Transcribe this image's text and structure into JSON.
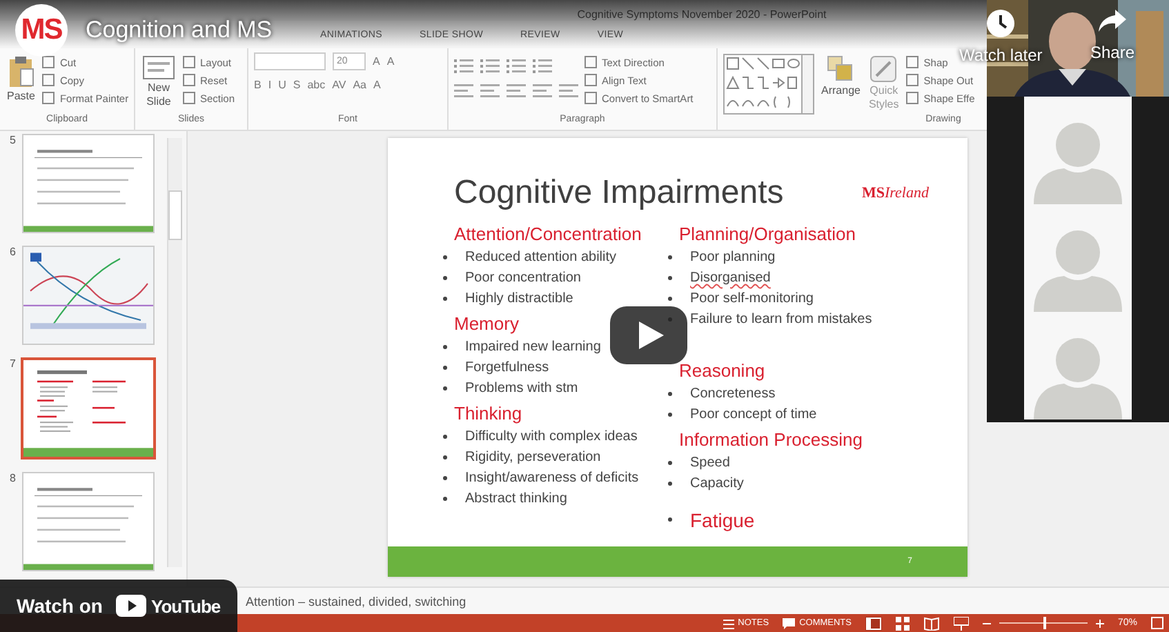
{
  "video": {
    "title": "Cognition and MS",
    "channel_logo": "MS",
    "watch_later": "Watch later",
    "share": "Share",
    "watch_on": "Watch on",
    "brand": "YouTube"
  },
  "window": {
    "title": "Cognitive Symptoms November 2020 - PowerPoint"
  },
  "ribbon_tabs": [
    "ANIMATIONS",
    "SLIDE SHOW",
    "REVIEW",
    "VIEW"
  ],
  "clipboard": {
    "label": "Clipboard",
    "paste": "Paste",
    "items": [
      "Cut",
      "Copy",
      "Format Painter"
    ]
  },
  "slides_group": {
    "label": "Slides",
    "new_slide": [
      "New",
      "Slide"
    ],
    "items": [
      "Layout",
      "Reset",
      "Section"
    ]
  },
  "font_group": {
    "label": "Font",
    "size": "20",
    "grow_shrink": [
      "A",
      "A"
    ],
    "buttons": [
      "B",
      "I",
      "U",
      "S",
      "abc",
      "AV",
      "Aa",
      "A"
    ]
  },
  "paragraph_group": {
    "label": "Paragraph",
    "items": [
      "Text Direction",
      "Align Text",
      "Convert to SmartArt"
    ]
  },
  "drawing_group": {
    "label": "Drawing",
    "arrange": "Arrange",
    "quick_styles": [
      "Quick",
      "Styles"
    ],
    "items": [
      "Shap",
      "Shape Out",
      "Shape Effe"
    ]
  },
  "thumbnails": [
    {
      "number": "5",
      "kind": "text",
      "selected": false
    },
    {
      "number": "6",
      "kind": "map",
      "selected": false
    },
    {
      "number": "7",
      "kind": "bullets",
      "selected": true
    },
    {
      "number": "8",
      "kind": "text",
      "selected": false
    }
  ],
  "slide": {
    "title": "Cognitive Impairments",
    "logo": {
      "mark": "MS",
      "word": "Ireland"
    },
    "page": "7",
    "columns": [
      [
        {
          "heading": "Attention/Concentration",
          "bullets": [
            {
              "text": "Reduced attention ability",
              "flagged": false
            },
            {
              "text": "Poor concentration",
              "flagged": false
            },
            {
              "text": "Highly distractible",
              "flagged": false
            }
          ]
        },
        {
          "heading": "Memory",
          "bullets": [
            {
              "text": "Impaired new learning",
              "flagged": false
            },
            {
              "text": "Forgetfulness",
              "flagged": false
            },
            {
              "text": "Problems with stm",
              "flagged": false
            }
          ]
        },
        {
          "heading": "Thinking",
          "bullets": [
            {
              "text": "Difficulty with complex ideas",
              "flagged": false
            },
            {
              "text": "Rigidity, perseveration",
              "flagged": false
            },
            {
              "text": "Insight/awareness of deficits",
              "flagged": false
            },
            {
              "text": "Abstract thinking",
              "flagged": false
            }
          ]
        }
      ],
      [
        {
          "heading": "Planning/Organisation",
          "bullets": [
            {
              "text": "Poor planning",
              "flagged": false
            },
            {
              "text": "Disorganised",
              "flagged": true
            },
            {
              "text": "Poor self-monitoring",
              "flagged": false
            },
            {
              "text": "Failure to learn from mistakes",
              "flagged": false
            }
          ]
        },
        {
          "heading": "Reasoning",
          "bullets": [
            {
              "text": "Concreteness",
              "flagged": false
            },
            {
              "text": "Poor concept of time",
              "flagged": false
            }
          ]
        },
        {
          "heading": "Information Processing",
          "bullets": [
            {
              "text": "Speed",
              "flagged": false
            },
            {
              "text": "Capacity",
              "flagged": false
            }
          ]
        },
        {
          "heading": "Fatigue",
          "kind": "bullet_heading"
        }
      ]
    ]
  },
  "notes": "Attention – sustained, divided, switching",
  "status_bar": {
    "notes": "NOTES",
    "comments": "COMMENTS",
    "zoom": {
      "level": 0.5,
      "reading": "70%"
    }
  },
  "participants": [
    {
      "kind": "avatar"
    },
    {
      "kind": "avatar"
    },
    {
      "kind": "avatar"
    }
  ]
}
